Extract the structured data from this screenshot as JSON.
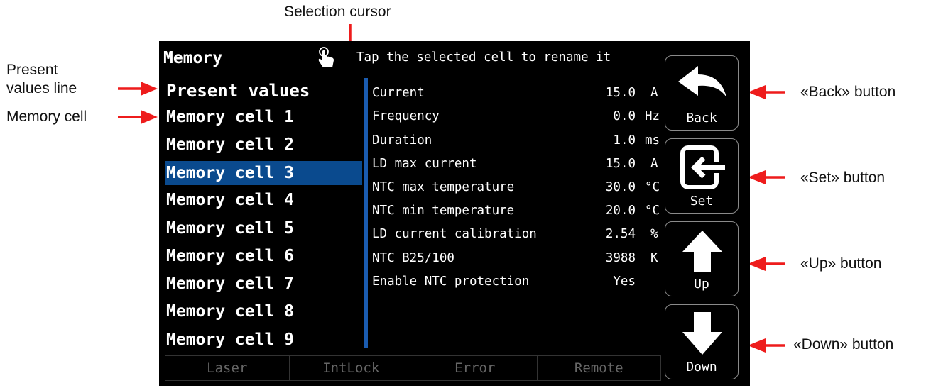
{
  "annotations": {
    "selection_cursor": "Selection cursor",
    "present_values_line": "Present\nvalues line",
    "memory_cell": "Memory cell",
    "back_button": "«Back» button",
    "set_button": "«Set» button",
    "up_button": "«Up» button",
    "down_button": "«Down» button"
  },
  "header": {
    "title": "Memory",
    "hint": "Tap the selected cell to rename it"
  },
  "cells": [
    {
      "label": "Present values"
    },
    {
      "label": "Memory cell 1"
    },
    {
      "label": "Memory cell 2"
    },
    {
      "label": "Memory cell 3"
    },
    {
      "label": "Memory cell 4"
    },
    {
      "label": "Memory cell 5"
    },
    {
      "label": "Memory cell 6"
    },
    {
      "label": "Memory cell 7"
    },
    {
      "label": "Memory cell 8"
    },
    {
      "label": "Memory cell 9"
    }
  ],
  "params": [
    {
      "name": "Current",
      "value": "15.0",
      "unit": "A"
    },
    {
      "name": "Frequency",
      "value": "0.0",
      "unit": "Hz"
    },
    {
      "name": "Duration",
      "value": "1.0",
      "unit": "ms"
    },
    {
      "name": "LD max current",
      "value": "15.0",
      "unit": "A"
    },
    {
      "name": "NTC max temperature",
      "value": "30.0",
      "unit": "°C"
    },
    {
      "name": "NTC min temperature",
      "value": "20.0",
      "unit": "°C"
    },
    {
      "name": "LD current calibration",
      "value": "2.54",
      "unit": "%"
    },
    {
      "name": "NTC B25/100",
      "value": "3988",
      "unit": "K"
    },
    {
      "name": "Enable NTC protection",
      "value": "Yes",
      "unit": ""
    }
  ],
  "status": [
    "Laser",
    "IntLock",
    "Error",
    "Remote"
  ],
  "buttons": {
    "back": "Back",
    "set": "Set",
    "up": "Up",
    "down": "Down"
  },
  "colors": {
    "selection": "#0a4a8e",
    "cursor_bar": "#1b5cb0",
    "annotation_arrow": "#ee1c1c"
  }
}
